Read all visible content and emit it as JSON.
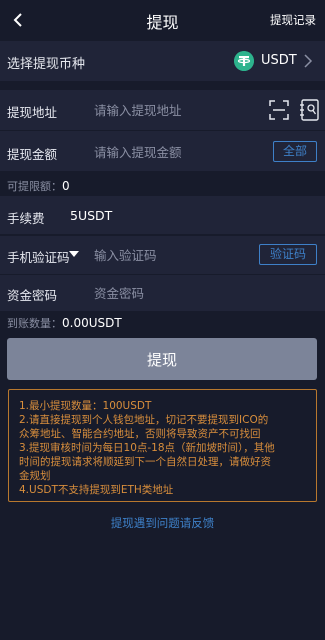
{
  "header": {
    "title": "提现",
    "record_label": "提现记录"
  },
  "coin": {
    "label": "选择提现币种",
    "name": "USDT",
    "icon": "tether-icon",
    "icon_color": "#2db38d"
  },
  "address": {
    "label": "提现地址",
    "placeholder": "请输入提现地址"
  },
  "amount": {
    "label": "提现金额",
    "placeholder": "请输入提现金额",
    "all_label": "全部"
  },
  "available": {
    "label": "可提限额：",
    "value": "0"
  },
  "fee": {
    "label": "手续费",
    "value": "5USDT"
  },
  "verify": {
    "label": "手机验证码",
    "placeholder": "输入验证码",
    "button_label": "验证码"
  },
  "password": {
    "label": "资金密码",
    "placeholder": "资金密码"
  },
  "arrival": {
    "label": "到账数量：",
    "value": "0.00USDT"
  },
  "submit_label": "提现",
  "notice": [
    "1.最小提现数量：100USDT",
    "2.请直接提现到个人钱包地址，切记不要提现到ICO的",
    "众筹地址、智能合约地址，否则将导致资产不可找回",
    "3.提现审核时间为每日10点-18点（新加坡时间），其他",
    "时间的提现请求将顺延到下一个自然日处理，请做好资",
    "金规划",
    "4.USDT不支持提现到ETH类地址"
  ],
  "feedback_label": "提现遇到问题请反馈",
  "colors": {
    "background": "#171b2b",
    "row_background": "#202438",
    "accent_blue": "#3e80c8",
    "notice_orange": "#d88e3c",
    "submit_disabled": "#7c8499"
  }
}
